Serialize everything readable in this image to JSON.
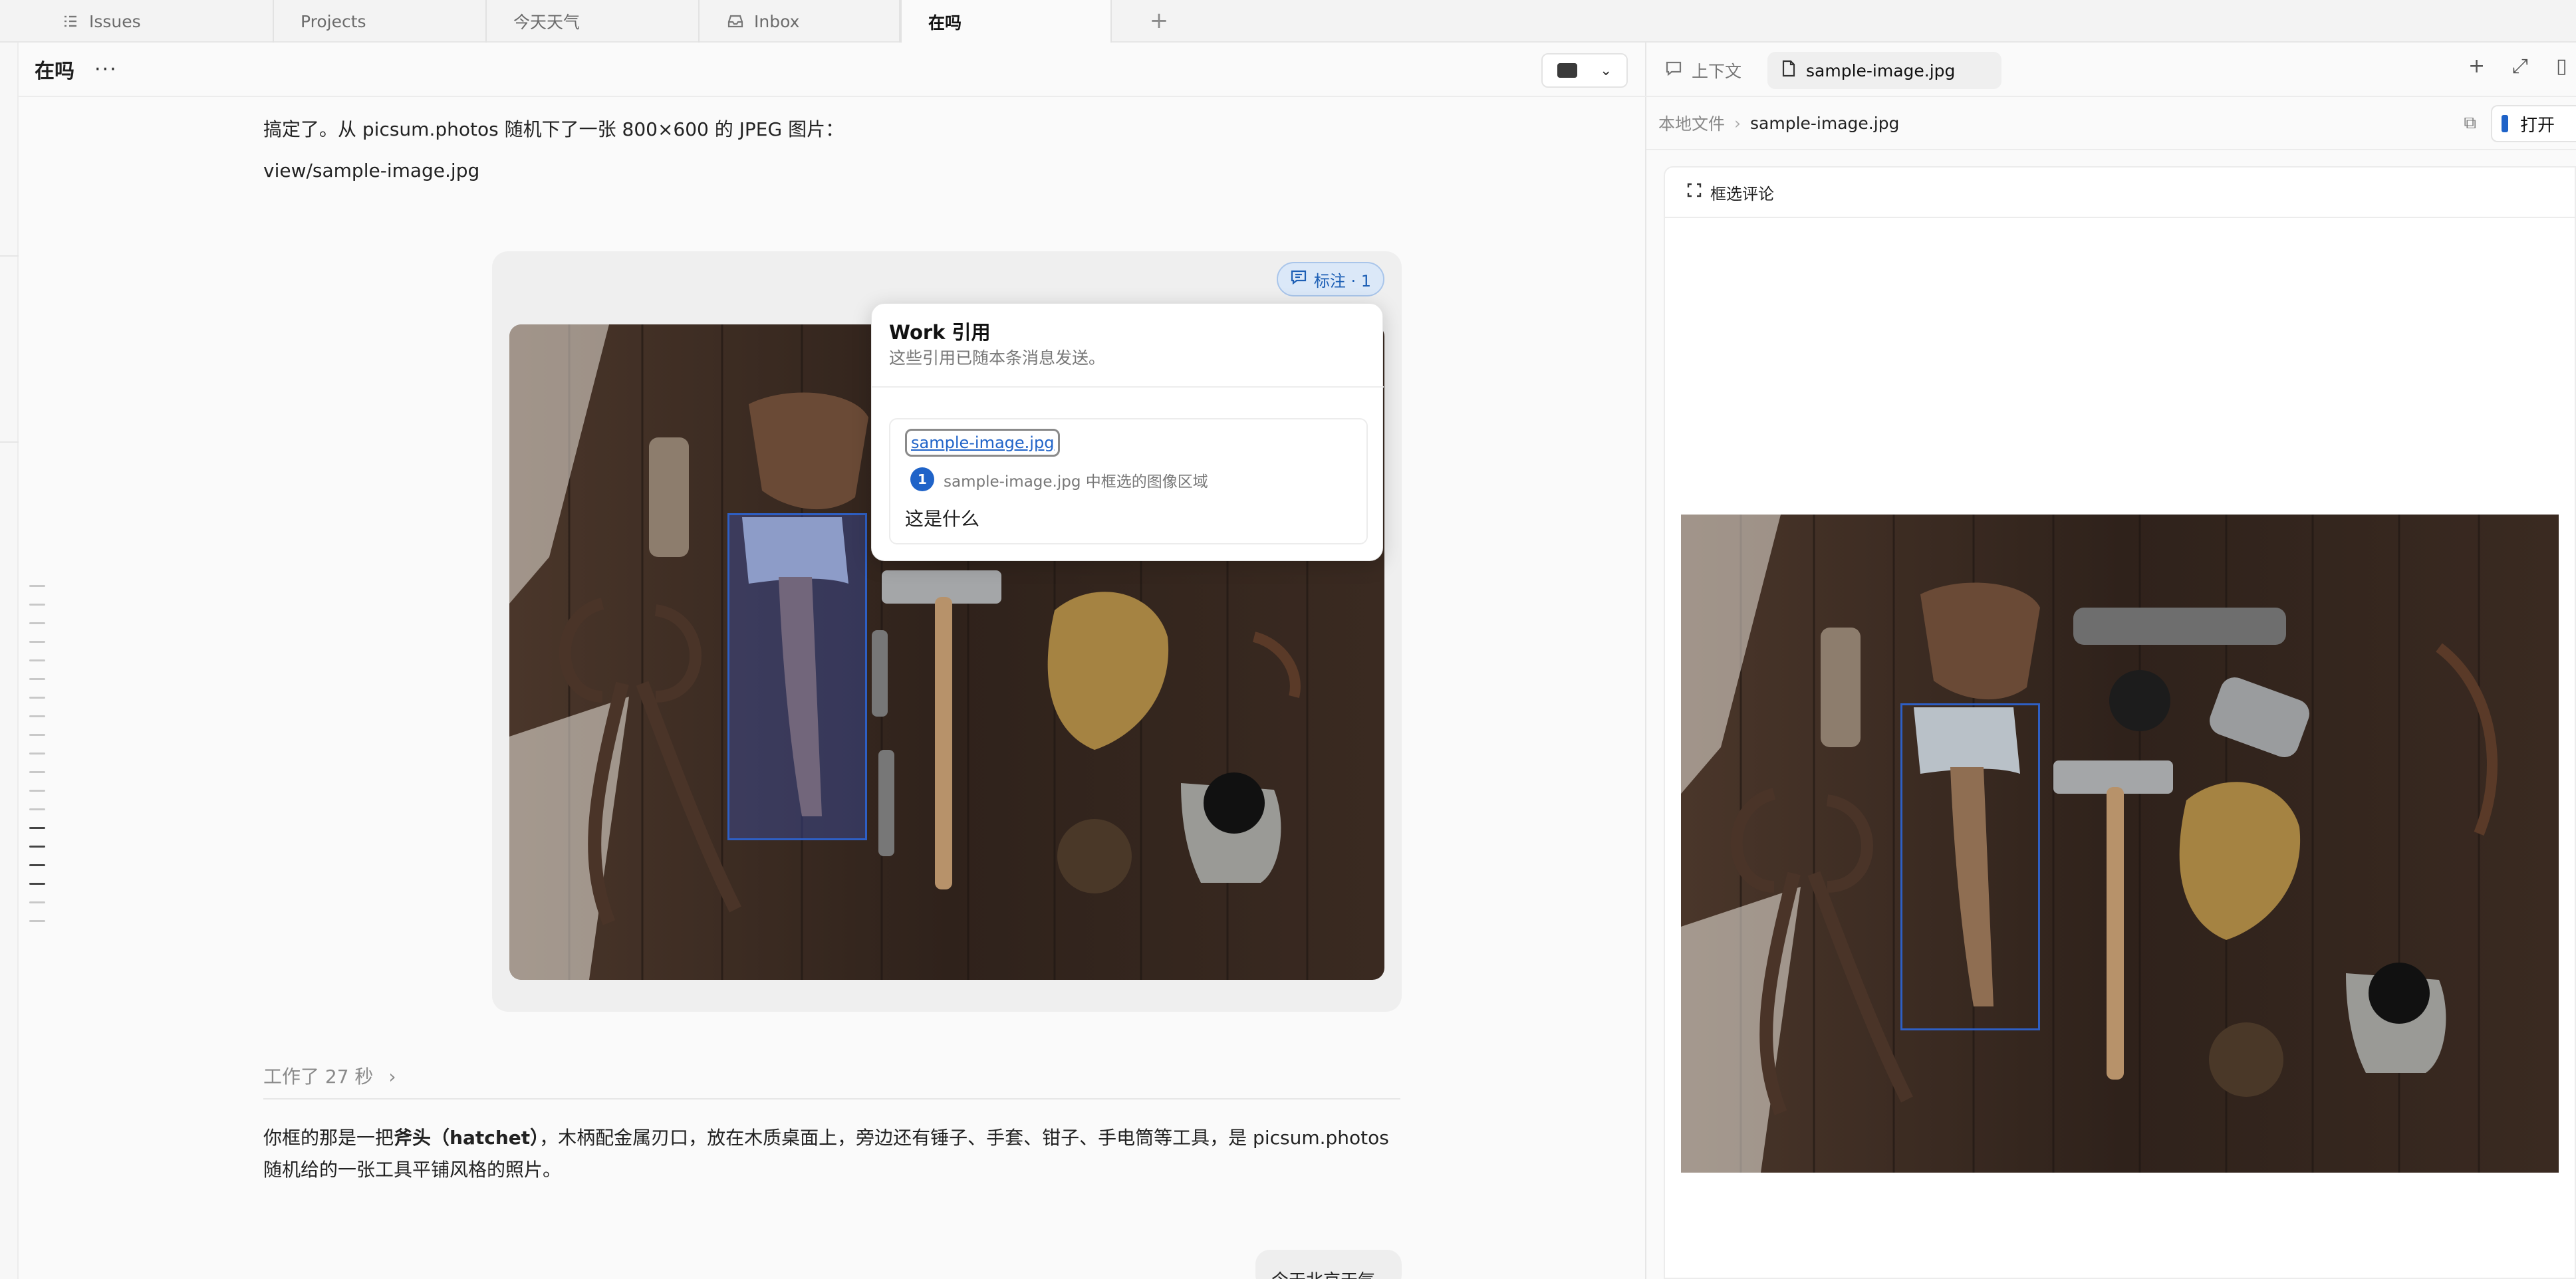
{
  "tabs": [
    {
      "label": "Issues",
      "icon": "list-icon"
    },
    {
      "label": "Projects",
      "icon": ""
    },
    {
      "label": "今天天气",
      "icon": ""
    },
    {
      "label": "Inbox",
      "icon": "inbox-icon"
    },
    {
      "label": "在吗",
      "icon": "",
      "active": true
    }
  ],
  "tab_add": "+",
  "chat": {
    "title": "在吗",
    "more": "···",
    "msg_line1": "搞定了。从 picsum.photos 随机下了一张 800×600 的 JPEG 图片：",
    "msg_line2": "view/sample-image.jpg",
    "annotation_badge": "标注 · 1",
    "popover": {
      "title": "Work 引用",
      "subtitle": "这些引用已随本条消息发送。",
      "file_link": "sample-image.jpg",
      "ref_number": "1",
      "ref_desc": "sample-image.jpg 中框选的图像区域",
      "question": "这是什么"
    },
    "worked": "工作了 27 秒",
    "worked_chevron": "›",
    "answer_pre": "你框的那是一把",
    "answer_bold": "斧头（hatchet）",
    "answer_post": "，木柄配金属刃口，放在木质桌面上，旁边还有锤子、手套、钳子、手电筒等工具，是 picsum.photos 随机给的一张工具平铺风格的照片。",
    "next_bubble": "今天北京天气"
  },
  "right": {
    "tab_context": "上下文",
    "tab_file": "sample-image.jpg",
    "breadcrumb_root": "本地文件",
    "breadcrumb_sep": "›",
    "breadcrumb_file": "sample-image.jpg",
    "open_label": "打开",
    "toolbar_label": "框选评论",
    "actions": [
      "+",
      "⤢",
      "▯"
    ]
  },
  "colors": {
    "accent": "#1f63c8",
    "selection_box": "#2e5fc4",
    "wood": "#3b2a20"
  }
}
